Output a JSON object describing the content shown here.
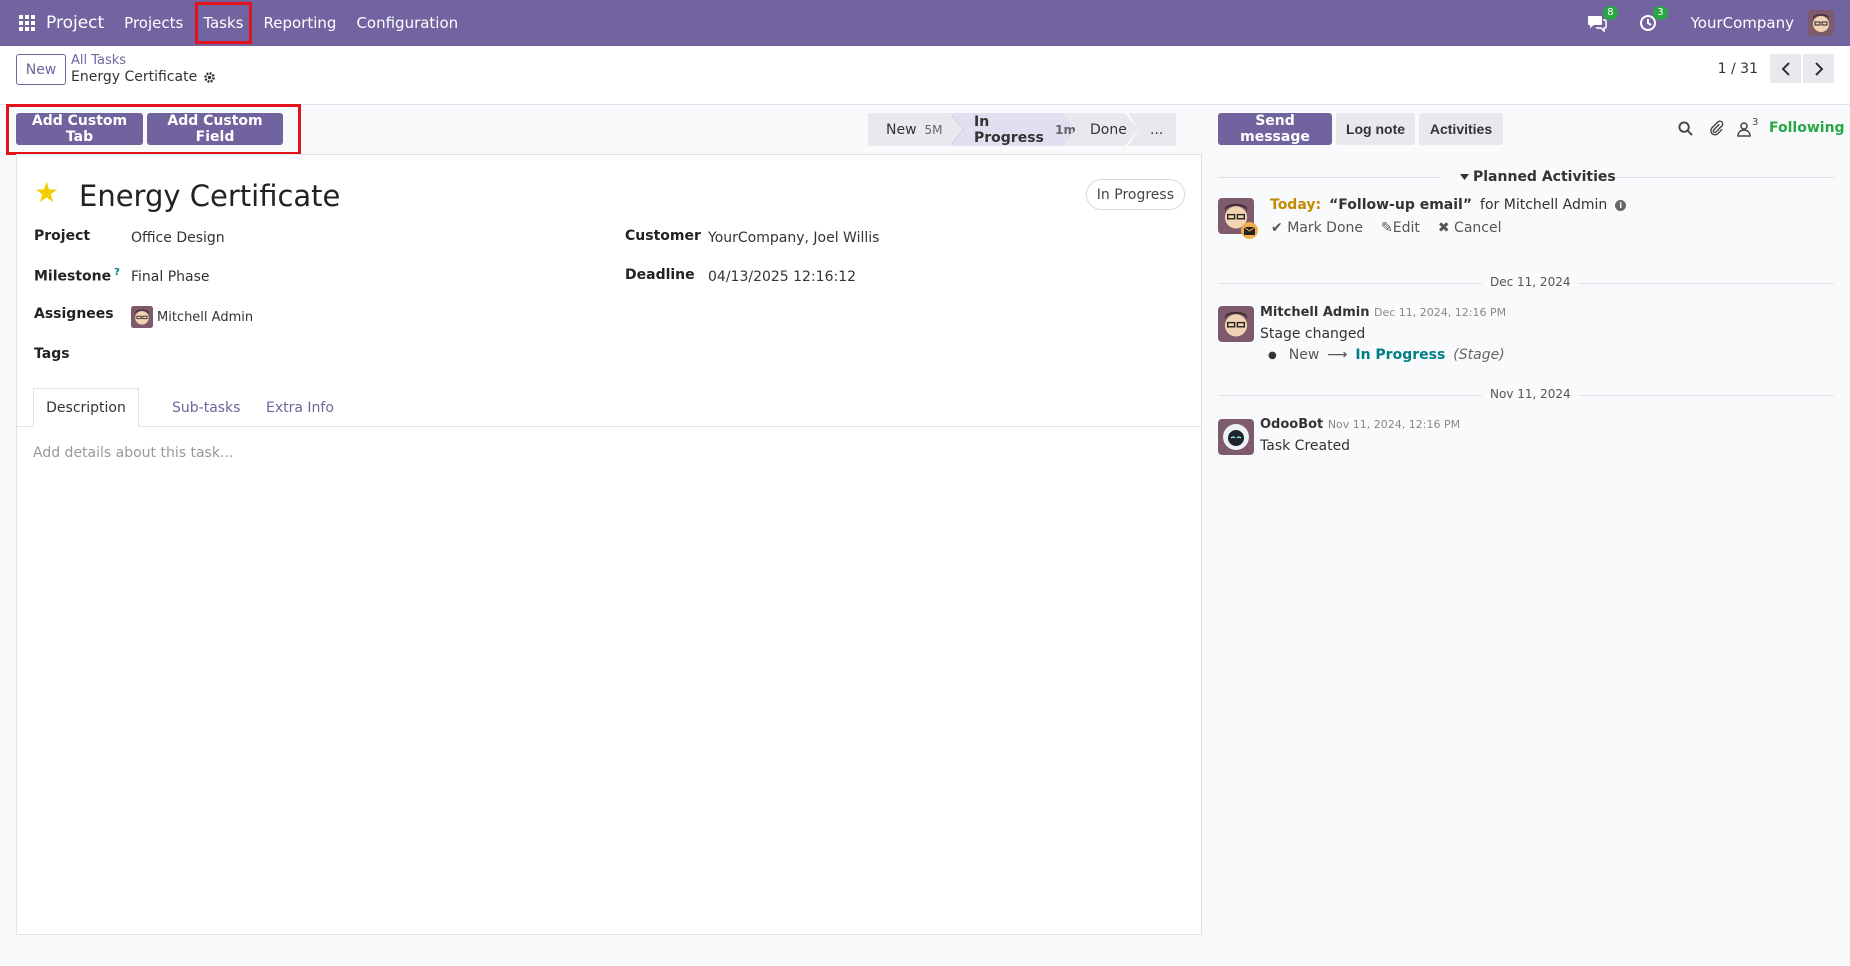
{
  "topbar": {
    "app_name": "Project",
    "menu": [
      "Projects",
      "Tasks",
      "Reporting",
      "Configuration"
    ],
    "messages_count": "8",
    "activities_count": "3",
    "company": "YourCompany"
  },
  "control": {
    "new_label": "New",
    "breadcrumb_parent": "All Tasks",
    "breadcrumb_current": "Energy Certificate",
    "pager": "1 / 31"
  },
  "buttons": {
    "add_custom_tab": "Add Custom Tab",
    "add_custom_field": "Add Custom Field"
  },
  "stages": [
    {
      "label": "New",
      "duration": "5M"
    },
    {
      "label": "In Progress",
      "duration": "1m"
    },
    {
      "label": "Done",
      "duration": ""
    },
    {
      "label": "...",
      "duration": ""
    }
  ],
  "record": {
    "title": "Energy Certificate",
    "status": "In Progress",
    "fields": {
      "project_label": "Project",
      "project": "Office Design",
      "milestone_label": "Milestone",
      "milestone_help": "?",
      "milestone": "Final Phase",
      "assignees_label": "Assignees",
      "assignee": "Mitchell Admin",
      "tags_label": "Tags",
      "customer_label": "Customer",
      "customer": "YourCompany, Joel Willis",
      "deadline_label": "Deadline",
      "deadline": "04/13/2025 12:16:12"
    },
    "tabs": [
      "Description",
      "Sub-tasks",
      "Extra Info"
    ],
    "description_placeholder": "Add details about this task..."
  },
  "chatter": {
    "send_message": "Send message",
    "log_note": "Log note",
    "activities": "Activities",
    "followers_count": "3",
    "following": "Following",
    "planned_title": "Planned Activities",
    "activity": {
      "when": "Today:",
      "summary": "“Follow-up email”",
      "for": "for Mitchell Admin",
      "mark_done": "Mark Done",
      "edit": "Edit",
      "cancel": "Cancel"
    },
    "messages": [
      {
        "date_sep": "Dec 11, 2024",
        "author": "Mitchell Admin",
        "time": "Dec 11, 2024, 12:16 PM",
        "body": "Stage changed",
        "change_from": "New",
        "change_to": "In Progress",
        "change_field": "(Stage)"
      },
      {
        "date_sep": "Nov 11, 2024",
        "author": "OdooBot",
        "time": "Nov 11, 2024, 12:16 PM",
        "body": "Task Created"
      }
    ]
  },
  "colors": {
    "brand": "#71639e",
    "topbar": "#7164a0",
    "star": "#f3cc00",
    "following": "#28a745",
    "highlight": "#e3131b",
    "today": "#c68a00"
  }
}
